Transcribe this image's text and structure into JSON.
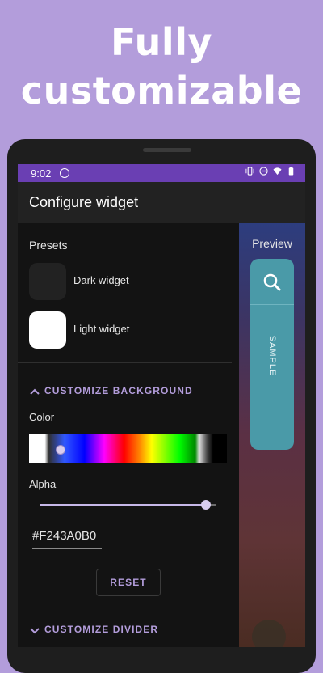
{
  "headline": {
    "line1": "Fully",
    "line2": "customizable"
  },
  "status_bar": {
    "time": "9:02",
    "icons": [
      "vibrate-icon",
      "dnd-icon",
      "wifi-icon",
      "battery-icon"
    ]
  },
  "app_bar": {
    "title": "Configure widget"
  },
  "presets": {
    "label": "Presets",
    "items": [
      {
        "label": "Dark widget",
        "swatch_color": "#222222"
      },
      {
        "label": "Light widget",
        "swatch_color": "#ffffff"
      }
    ]
  },
  "background": {
    "section_title": "CUSTOMIZE BACKGROUND",
    "color_label": "Color",
    "alpha_label": "Alpha",
    "alpha_value": 0.94,
    "hex_value": "#F243A0B0",
    "reset_label": "RESET"
  },
  "divider_section": {
    "section_title": "CUSTOMIZE DIVIDER"
  },
  "preview": {
    "label": "Preview",
    "sample_text": "SAMPLE",
    "widget_color": "#4a9aa8"
  },
  "colors": {
    "accent": "#b39ddb",
    "status_bar": "#6a3fb3",
    "app_bar": "#222222",
    "background": "#131313"
  }
}
